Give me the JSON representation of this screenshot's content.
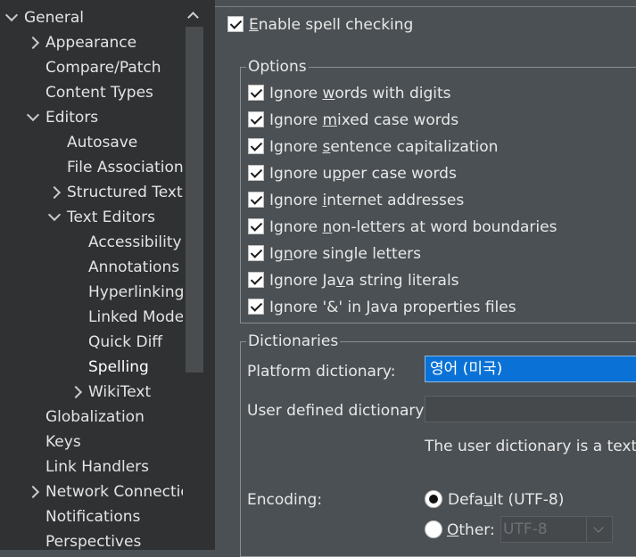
{
  "tree": {
    "items": [
      {
        "label": "General",
        "chevron": "expanded"
      },
      {
        "label": "Appearance",
        "chevron": "collapsed"
      },
      {
        "label": "Compare/Patch",
        "chevron": "none"
      },
      {
        "label": "Content Types",
        "chevron": "none"
      },
      {
        "label": "Editors",
        "chevron": "expanded"
      },
      {
        "label": "Autosave",
        "chevron": "none"
      },
      {
        "label": "File Associations",
        "chevron": "none"
      },
      {
        "label": "Structured Text",
        "chevron": "collapsed"
      },
      {
        "label": "Text Editors",
        "chevron": "expanded"
      },
      {
        "label": "Accessibility",
        "chevron": "none"
      },
      {
        "label": "Annotations",
        "chevron": "none"
      },
      {
        "label": "Hyperlinking",
        "chevron": "none"
      },
      {
        "label": "Linked Mode",
        "chevron": "none"
      },
      {
        "label": "Quick Diff",
        "chevron": "none"
      },
      {
        "label": "Spelling",
        "chevron": "none",
        "selected": true
      },
      {
        "label": "WikiText",
        "chevron": "collapsed"
      },
      {
        "label": "Globalization",
        "chevron": "none"
      },
      {
        "label": "Keys",
        "chevron": "none"
      },
      {
        "label": "Link Handlers",
        "chevron": "none"
      },
      {
        "label": "Network Connections",
        "chevron": "collapsed"
      },
      {
        "label": "Notifications",
        "chevron": "none"
      },
      {
        "label": "Perspectives",
        "chevron": "none"
      }
    ]
  },
  "spelling": {
    "enable_label": "Enable spell checking",
    "enable_checked": true,
    "options_legend": "Options",
    "options": [
      {
        "pre": "Ignore ",
        "mn": "w",
        "post": "ords with digits",
        "checked": true
      },
      {
        "pre": "Ignore ",
        "mn": "m",
        "post": "ixed case words",
        "checked": true
      },
      {
        "pre": "Ignore ",
        "mn": "s",
        "post": "entence capitalization",
        "checked": true
      },
      {
        "pre": "Ignore u",
        "mn": "p",
        "post": "per case words",
        "checked": true
      },
      {
        "pre": "Ignore ",
        "mn": "i",
        "post": "nternet addresses",
        "checked": true
      },
      {
        "pre": "Ignore ",
        "mn": "n",
        "post": "on-letters at word boundaries",
        "checked": true
      },
      {
        "pre": "Ig",
        "mn": "n",
        "post": "ore single letters",
        "checked": true
      },
      {
        "pre": "Ignore Ja",
        "mn": "v",
        "post": "a string literals",
        "checked": true
      },
      {
        "pre": "Ignore '&' in ",
        "mn": "J",
        "post": "ava properties files",
        "checked": true
      }
    ],
    "dictionaries_legend": "Dictionaries",
    "platform_dict_label": "Platform dictionary:",
    "platform_dict_value": "영어 (미국)",
    "user_dict_label": "User defined dictionary:",
    "user_dict_value": "",
    "user_dict_hint": "The user dictionary is a text f",
    "encoding_label": "Encoding:",
    "encoding_default_pre": "Defa",
    "encoding_default_mn": "u",
    "encoding_default_post": "lt (UTF-8)",
    "encoding_default_selected": true,
    "encoding_other_mn": "O",
    "encoding_other_post": "ther:",
    "encoding_other_value": "UTF-8"
  }
}
